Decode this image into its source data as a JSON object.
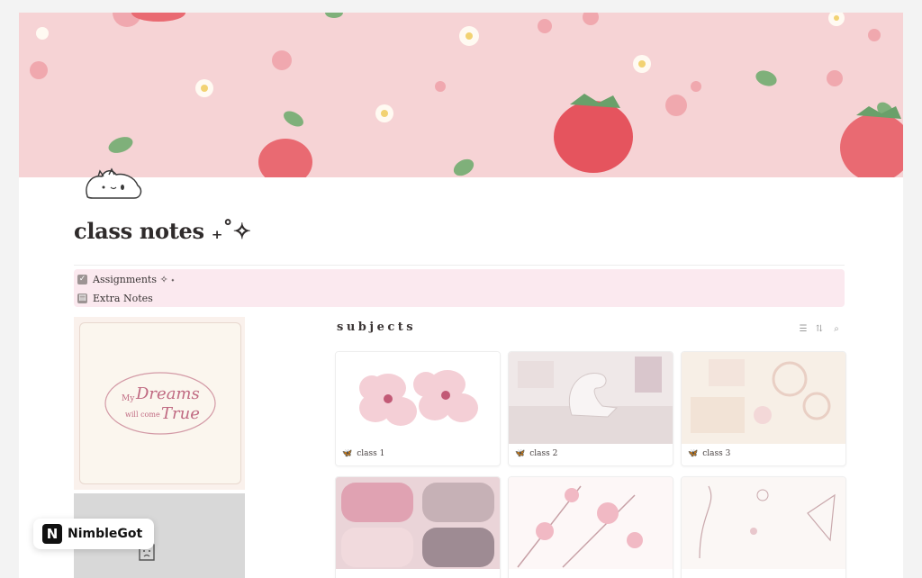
{
  "page": {
    "title": "class notes ₊˚✧",
    "icon": "cat-icon"
  },
  "links": [
    {
      "label": "Assignments ✧ ˖",
      "icon": "checkbox-icon"
    },
    {
      "label": "Extra Notes",
      "icon": "page-icon"
    }
  ],
  "sidebar": {
    "dream_card": {
      "line1": "My",
      "line2": "Dreams",
      "line3": "will come",
      "line4": "True"
    }
  },
  "gallery": {
    "title": "subjects",
    "tools": [
      "filter-icon",
      "sort-icon",
      "search-icon"
    ],
    "cards": [
      {
        "label": "class 1",
        "icon": "butterfly-icon"
      },
      {
        "label": "class 2",
        "icon": "butterfly-icon"
      },
      {
        "label": "class 3",
        "icon": "butterfly-icon"
      },
      {
        "label": "",
        "icon": ""
      },
      {
        "label": "",
        "icon": ""
      },
      {
        "label": "",
        "icon": ""
      }
    ]
  },
  "watermark": {
    "logo": "N",
    "name": "NimbleGot"
  },
  "colors": {
    "cover_bg": "#f6d3d5",
    "links_bg": "#fbe9ef",
    "accent_pink": "#c9738a"
  }
}
